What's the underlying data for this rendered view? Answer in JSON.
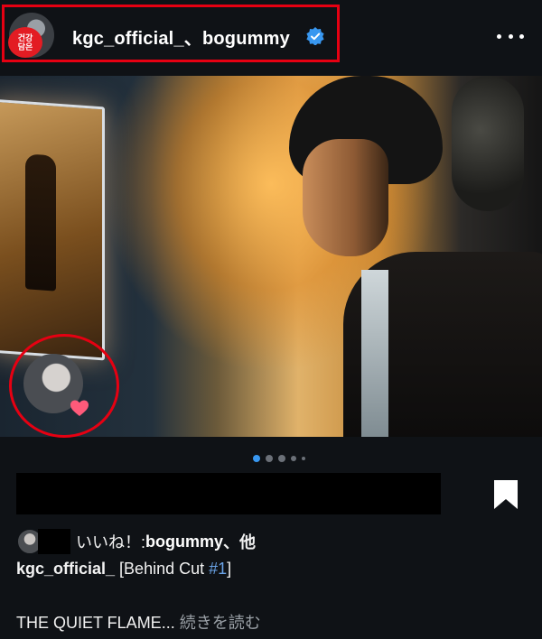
{
  "post": {
    "header": {
      "badge_line1": "건강",
      "badge_line2": "담은",
      "username": "kgc_official_、bogummy",
      "verified_icon": "verified-badge-icon",
      "more_icon": "more-options-icon"
    },
    "carousel": {
      "total_dots": 5,
      "active_index": 0
    },
    "likes": {
      "prefix": "いいね！: ",
      "user": "bogummy",
      "suffix": "、他"
    },
    "caption": {
      "user": "kgc_official_",
      "text_before": " [Behind Cut ",
      "hashtag": "#1",
      "text_after": "]"
    },
    "description": {
      "text": "THE QUIET FLAME... ",
      "more_label": "続きを読む"
    }
  },
  "colors": {
    "background": "#0f1216",
    "highlight_red": "#e60012",
    "verified_blue": "#3897f0",
    "hashtag_blue": "#6aa3e6"
  }
}
